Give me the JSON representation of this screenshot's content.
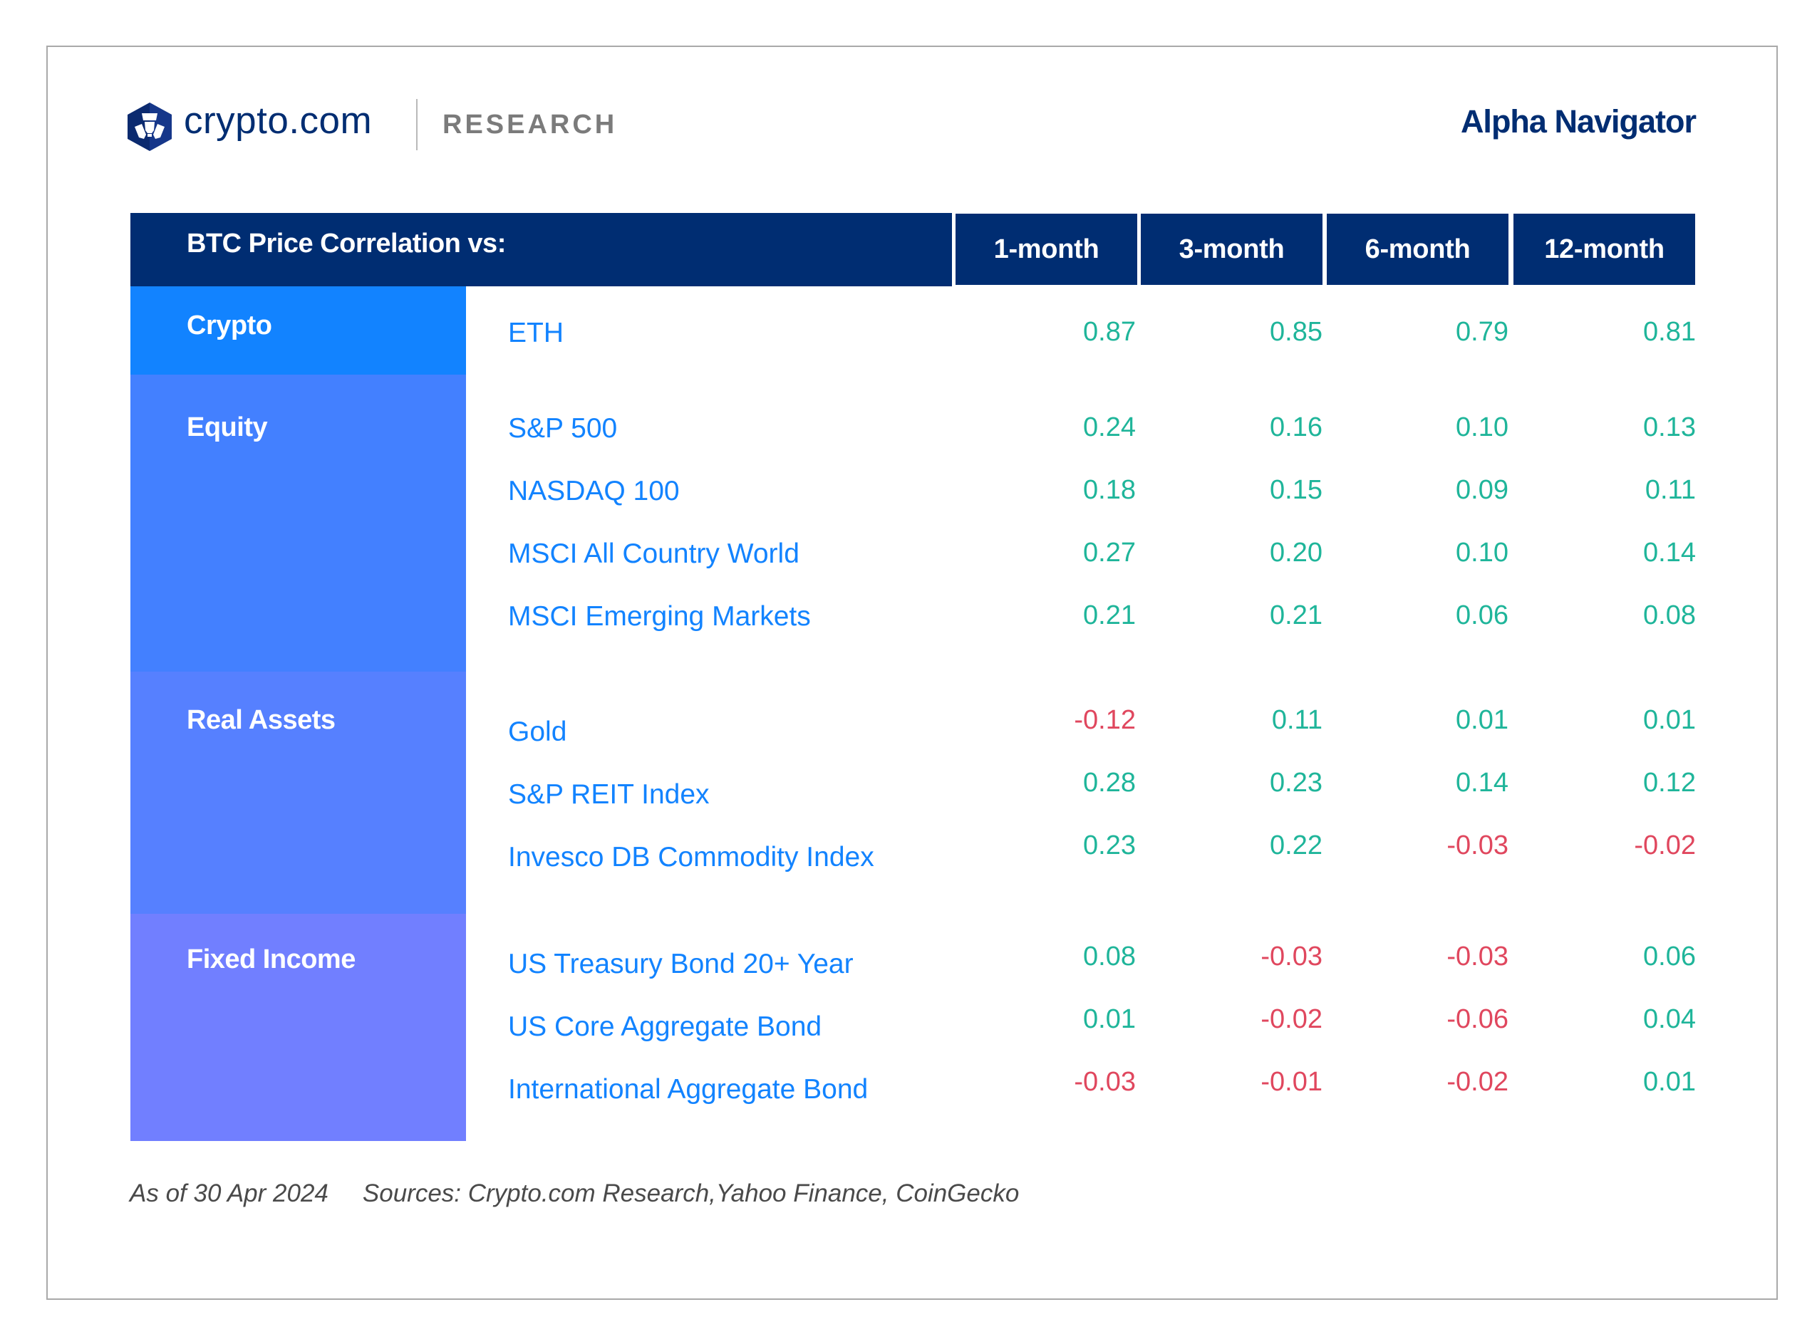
{
  "header": {
    "brand_name": "crypto.com",
    "section_label": "RESEARCH",
    "report_title": "Alpha Navigator",
    "logo_icon": "crypto-com-lion-hexagon-icon"
  },
  "colors": {
    "navy": "#002d72",
    "positive": "#1fb59a",
    "negative": "#e0475e",
    "asset_text": "#1283ff",
    "crypto": "#1283ff",
    "equity": "#4380ff",
    "real_assets": "#5680ff",
    "fixed_income": "#717fff"
  },
  "table": {
    "title": "BTC Price Correlation vs:",
    "columns": [
      "1-month",
      "3-month",
      "6-month",
      "12-month"
    ],
    "groups": [
      {
        "category": "Crypto",
        "rows": [
          {
            "asset": "ETH",
            "values": [
              "0.87",
              "0.85",
              "0.79",
              "0.81"
            ]
          }
        ]
      },
      {
        "category": "Equity",
        "rows": [
          {
            "asset": "S&P 500",
            "values": [
              "0.24",
              "0.16",
              "0.10",
              "0.13"
            ]
          },
          {
            "asset": "NASDAQ 100",
            "values": [
              "0.18",
              "0.15",
              "0.09",
              "0.11"
            ]
          },
          {
            "asset": "MSCI All Country World",
            "values": [
              "0.27",
              "0.20",
              "0.10",
              "0.14"
            ]
          },
          {
            "asset": "MSCI Emerging Markets",
            "values": [
              "0.21",
              "0.21",
              "0.06",
              "0.08"
            ]
          }
        ]
      },
      {
        "category": "Real Assets",
        "rows": [
          {
            "asset": "Gold",
            "values": [
              "-0.12",
              "0.11",
              "0.01",
              "0.01"
            ]
          },
          {
            "asset": "S&P REIT Index",
            "values": [
              "0.28",
              "0.23",
              "0.14",
              "0.12"
            ]
          },
          {
            "asset": "Invesco DB Commodity Index",
            "values": [
              "0.23",
              "0.22",
              "-0.03",
              "-0.02"
            ]
          }
        ]
      },
      {
        "category": "Fixed Income",
        "rows": [
          {
            "asset": "US Treasury Bond 20+ Year",
            "values": [
              "0.08",
              "-0.03",
              "-0.03",
              "0.06"
            ]
          },
          {
            "asset": "US Core Aggregate Bond",
            "values": [
              "0.01",
              "-0.02",
              "-0.06",
              "0.04"
            ]
          },
          {
            "asset": "International Aggregate Bond",
            "values": [
              "-0.03",
              "-0.01",
              "-0.02",
              "0.01"
            ]
          }
        ]
      }
    ]
  },
  "footer": {
    "as_of": "As of 30 Apr 2024",
    "sources": "Sources: Crypto.com Research,Yahoo Finance, CoinGecko"
  }
}
